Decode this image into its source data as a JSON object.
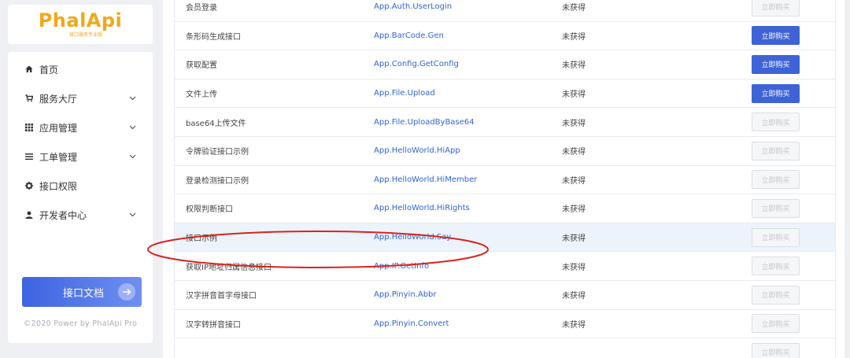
{
  "logo": {
    "text": "PhalApi",
    "subtitle": "接口服务专业版"
  },
  "sidebar": {
    "items": [
      {
        "label": "首页",
        "icon": "home-icon",
        "has_children": false
      },
      {
        "label": "服务大厅",
        "icon": "cart-icon",
        "has_children": true
      },
      {
        "label": "应用管理",
        "icon": "grid-icon",
        "has_children": true
      },
      {
        "label": "工单管理",
        "icon": "list-icon",
        "has_children": true
      },
      {
        "label": "接口权限",
        "icon": "gear-icon",
        "has_children": false
      },
      {
        "label": "开发者中心",
        "icon": "user-icon",
        "has_children": true
      }
    ],
    "doc_button": "接口文档",
    "copyright": "©2020 Power by PhalApi Pro"
  },
  "table": {
    "rows": [
      {
        "name": "会员登录",
        "api": "App.Auth.UserLogin",
        "status": "未获得",
        "button": "立即购买",
        "enabled": false
      },
      {
        "name": "条形码生成接口",
        "api": "App.BarCode.Gen",
        "status": "未获得",
        "button": "立即购买",
        "enabled": true
      },
      {
        "name": "获取配置",
        "api": "App.Config.GetConfig",
        "status": "未获得",
        "button": "立即购买",
        "enabled": true
      },
      {
        "name": "文件上传",
        "api": "App.File.Upload",
        "status": "未获得",
        "button": "立即购买",
        "enabled": true
      },
      {
        "name": "base64上传文件",
        "api": "App.File.UploadByBase64",
        "status": "未获得",
        "button": "立即购买",
        "enabled": false
      },
      {
        "name": "令牌验证接口示例",
        "api": "App.HelloWorld.HiApp",
        "status": "未获得",
        "button": "立即购买",
        "enabled": false
      },
      {
        "name": "登录检测接口示例",
        "api": "App.HelloWorld.HiMember",
        "status": "未获得",
        "button": "立即购买",
        "enabled": false
      },
      {
        "name": "权限判断接口",
        "api": "App.HelloWorld.HiRights",
        "status": "未获得",
        "button": "立即购买",
        "enabled": false
      },
      {
        "name": "接口示例",
        "api": "App.HelloWorld.Say",
        "status": "未获得",
        "button": "立即购买",
        "enabled": false,
        "highlighted": true
      },
      {
        "name": "获取IP地址归属信息接口",
        "api": "App.IP.GetInfo",
        "status": "未获得",
        "button": "立即购买",
        "enabled": false
      },
      {
        "name": "汉字拼音首字母接口",
        "api": "App.Pinyin.Abbr",
        "status": "未获得",
        "button": "立即购买",
        "enabled": false
      },
      {
        "name": "汉字转拼音接口",
        "api": "App.Pinyin.Convert",
        "status": "未获得",
        "button": "立即购买",
        "enabled": false
      },
      {
        "name": "",
        "api": "",
        "status": "",
        "button": "立即购买",
        "enabled": false
      }
    ]
  },
  "colors": {
    "accent": "#3d63d6",
    "logo": "#f0a81a",
    "annotation": "#d9231d",
    "link": "#2f63d6"
  }
}
